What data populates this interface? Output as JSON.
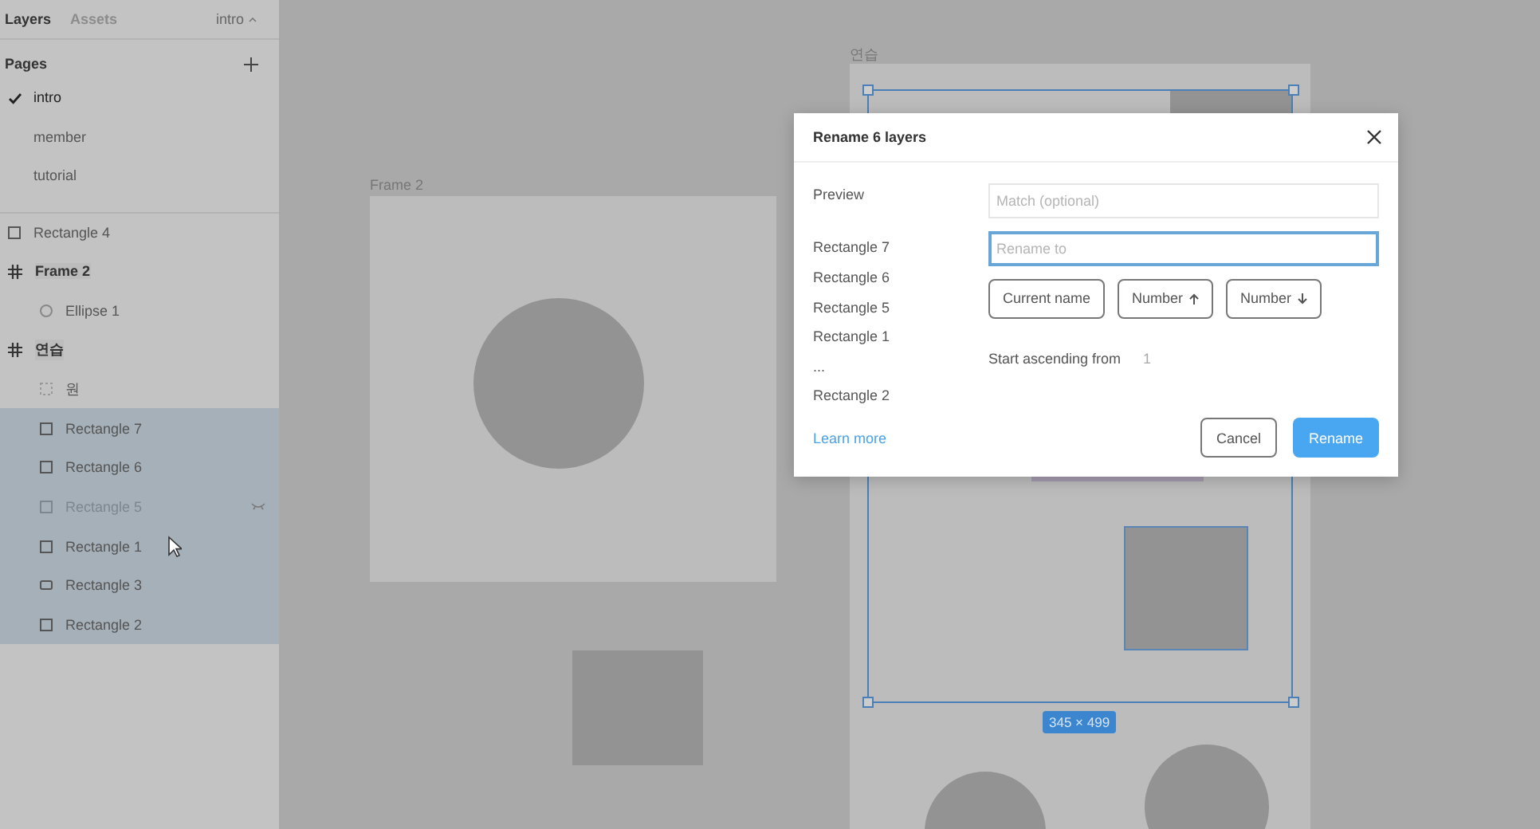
{
  "sidebar": {
    "tabs": [
      {
        "label": "Layers",
        "selected": true
      },
      {
        "label": "Assets",
        "selected": false
      }
    ],
    "page_menu": {
      "label": "intro"
    },
    "pages_title": "Pages",
    "pages": [
      {
        "label": "intro",
        "selected": true
      },
      {
        "label": "member",
        "selected": false
      },
      {
        "label": "tutorial",
        "selected": false
      }
    ],
    "layers": [
      {
        "name": "Rectangle 4",
        "kind": "rectangle",
        "selected": false,
        "hidden": false
      },
      {
        "name": "Frame 2",
        "kind": "frame",
        "selected": false,
        "hidden": false,
        "children": [
          {
            "name": "Ellipse 1",
            "kind": "ellipse",
            "selected": false,
            "hidden": false
          }
        ]
      },
      {
        "name": "연습",
        "kind": "frame",
        "selected": false,
        "hidden": false,
        "children": [
          {
            "name": "원",
            "kind": "group",
            "selected": false,
            "hidden": false
          },
          {
            "name": "Rectangle 7",
            "kind": "rectangle",
            "selected": true,
            "hidden": false
          },
          {
            "name": "Rectangle 6",
            "kind": "rectangle",
            "selected": true,
            "hidden": false
          },
          {
            "name": "Rectangle 5",
            "kind": "rectangle",
            "selected": true,
            "hidden": true
          },
          {
            "name": "Rectangle 1",
            "kind": "rectangle",
            "selected": true,
            "hidden": false
          },
          {
            "name": "Rectangle 3",
            "kind": "wide-rectangle",
            "selected": true,
            "hidden": false
          },
          {
            "name": "Rectangle 2",
            "kind": "rectangle",
            "selected": true,
            "hidden": false
          }
        ]
      }
    ]
  },
  "canvas": {
    "frames": [
      {
        "label": "Frame 2"
      },
      {
        "label": "연습"
      }
    ],
    "size_badge": "345 × 499"
  },
  "dialog": {
    "title": "Rename 6 layers",
    "preview_title": "Preview",
    "preview": [
      "Rectangle 7",
      "Rectangle 6",
      "Rectangle 5",
      "Rectangle 1",
      "...",
      "Rectangle 2"
    ],
    "match": {
      "placeholder": "Match (optional)"
    },
    "rename": {
      "placeholder": "Rename to",
      "focused": true
    },
    "tokens": [
      {
        "label": "Current name",
        "kind": "plain"
      },
      {
        "label": "Number",
        "kind": "up"
      },
      {
        "label": "Number",
        "kind": "down"
      }
    ],
    "start_label": "Start ascending from",
    "start_value": "1",
    "learn_more": "Learn more",
    "cancel": "Cancel",
    "confirm": "Rename"
  }
}
